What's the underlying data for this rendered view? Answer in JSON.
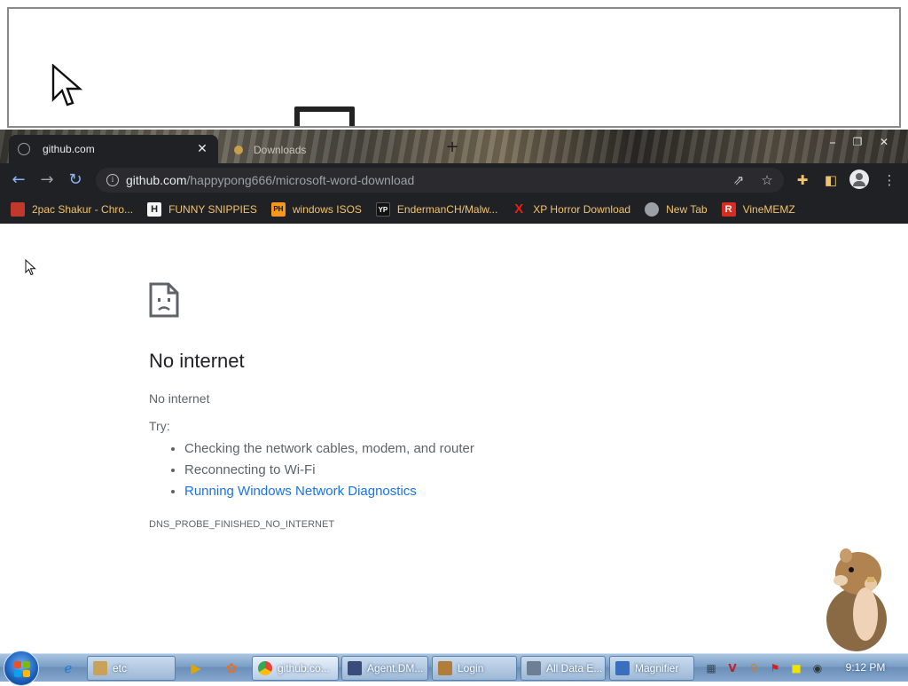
{
  "browser": {
    "tabs": [
      {
        "title": "github.com",
        "close_glyph": "✕"
      },
      {
        "title": "Downloads"
      }
    ],
    "new_tab_glyph": "+",
    "window_controls": [
      "⎯",
      "❐",
      "✕"
    ],
    "address": {
      "host": "github.com",
      "path": "/happypong666/microsoft-word-download"
    },
    "icons": {
      "back": "back-arrow-icon",
      "forward": "forward-arrow-icon",
      "reload": "reload-icon",
      "info": "site-info-icon",
      "share": "share-icon",
      "star": "bookmark-star-icon",
      "extensions": "puzzle-extensions-icon",
      "sidepanel": "side-panel-icon",
      "profile": "profile-avatar-icon",
      "menu": "kebab-menu-icon"
    },
    "bookmarks": [
      {
        "label": "2pac Shakur - Chro...",
        "icon_text": "",
        "icon_color": "#c0392b"
      },
      {
        "label": "FUNNY SNIPPIES",
        "icon_text": "H",
        "icon_color": "#202124"
      },
      {
        "label": "windows ISOS",
        "icon_text": "PH",
        "icon_color": "#f7971d"
      },
      {
        "label": "EndermanCH/Malw...",
        "icon_text": "YP",
        "icon_color": "#202124"
      },
      {
        "label": "XP Horror Download",
        "icon_text": "X",
        "icon_color": "#e62117"
      },
      {
        "label": "New Tab",
        "icon_text": "",
        "icon_color": "#9aa0a6"
      },
      {
        "label": "VineMEMZ",
        "icon_text": "R",
        "icon_color": "#d62d20"
      }
    ]
  },
  "error_page": {
    "title": "No internet",
    "subtitle": "No internet",
    "try_label": "Try:",
    "suggestions": [
      "Checking the network cables, modem, and router",
      "Reconnecting to Wi-Fi"
    ],
    "diagnostics_link": "Running Windows Network Diagnostics",
    "error_code": "DNS_PROBE_FINISHED_NO_INTERNET"
  },
  "taskbar": {
    "buttons": [
      {
        "label": "etc",
        "icon_color": "#c9a25a"
      },
      {
        "label": "github.co...",
        "icon_color": "#4285f4",
        "active": true
      },
      {
        "label": "Agent.DM...",
        "icon_color": "#3b4c7a"
      },
      {
        "label": "Login",
        "icon_color": "#b07d3a"
      },
      {
        "label": "All Data E...",
        "icon_color": "#6d7f95"
      },
      {
        "label": "Magnifier",
        "icon_color": "#3a6fc0"
      }
    ],
    "clock": "9:12 PM"
  },
  "colors": {
    "link": "#1a73e8",
    "bookmark_text": "#f0c36d",
    "toolbar_bg": "#202124"
  }
}
